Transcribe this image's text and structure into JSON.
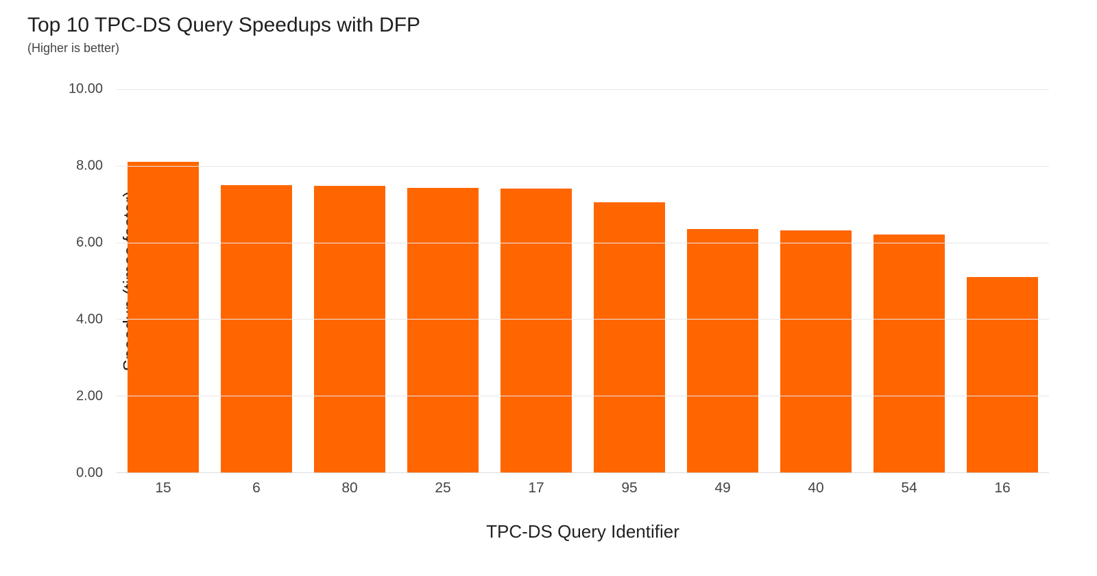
{
  "chart_data": {
    "type": "bar",
    "title": "Top 10 TPC-DS Query Speedups with DFP",
    "subtitle": "(Higher is better)",
    "xlabel": "TPC-DS Query Identifier",
    "ylabel": "Speedup (times faster)",
    "categories": [
      "15",
      "6",
      "80",
      "25",
      "17",
      "95",
      "49",
      "40",
      "54",
      "16"
    ],
    "values": [
      8.1,
      7.5,
      7.48,
      7.43,
      7.4,
      7.05,
      6.35,
      6.32,
      6.2,
      5.1
    ],
    "ylim": [
      0,
      10
    ],
    "yticks": [
      "0.00",
      "2.00",
      "4.00",
      "6.00",
      "8.00",
      "10.00"
    ],
    "bar_color": "#ff6600"
  }
}
